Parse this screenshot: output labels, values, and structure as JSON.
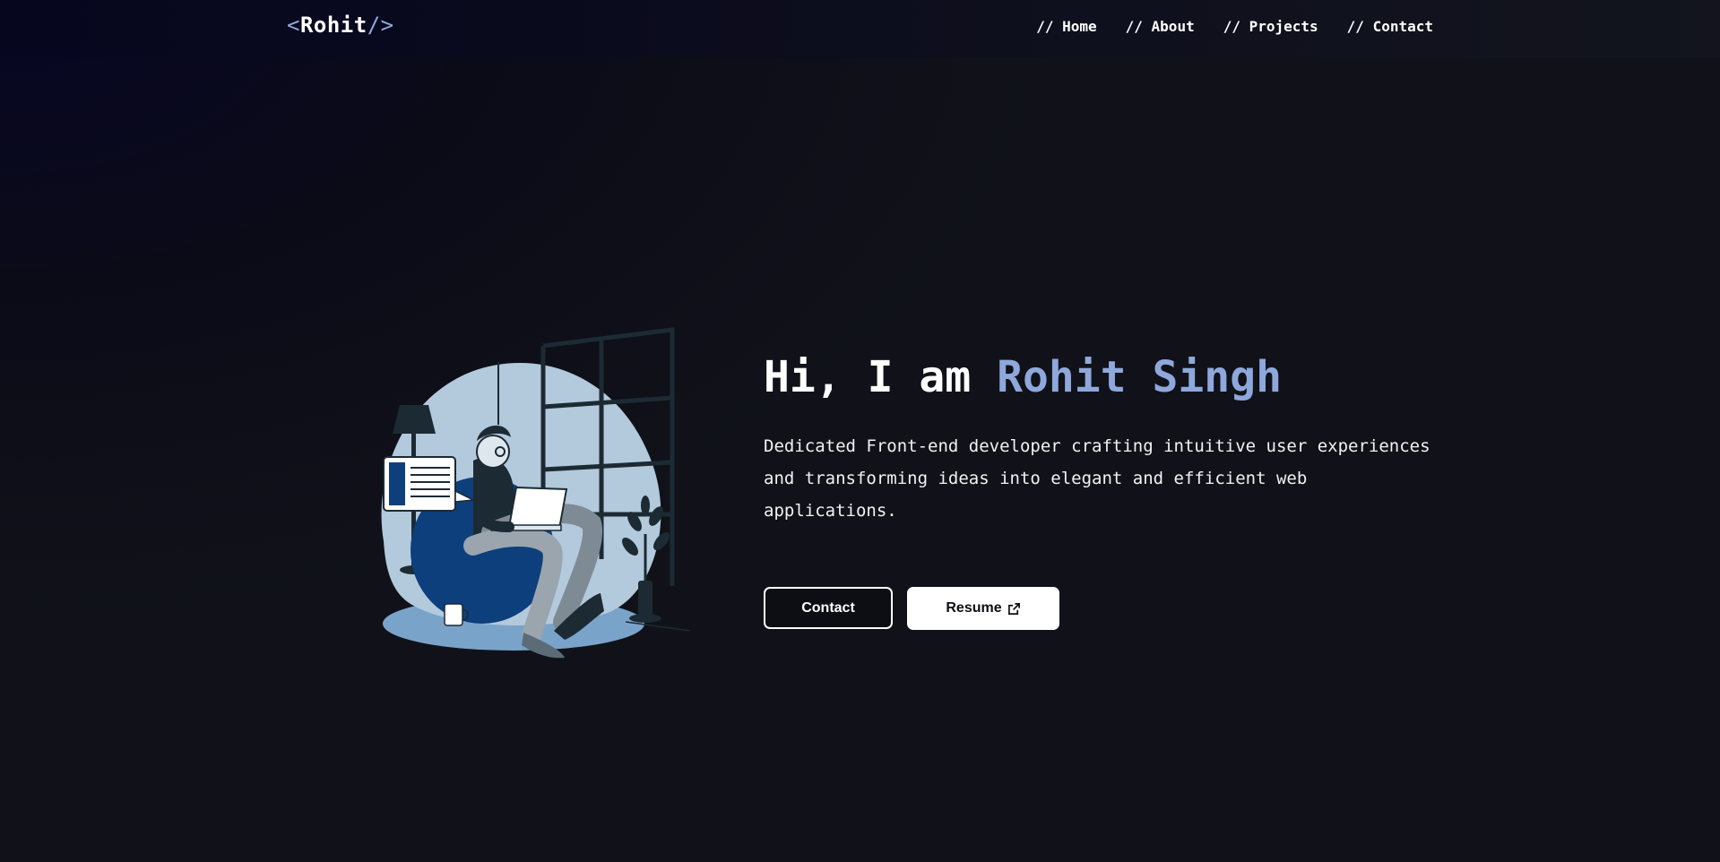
{
  "nav": {
    "logo_open": "<",
    "logo_name": "Rohit",
    "logo_close": "/>",
    "links": [
      "// Home",
      "// About",
      "// Projects",
      "// Contact"
    ]
  },
  "hero": {
    "greeting": "Hi, I am",
    "name": "Rohit Singh",
    "description": "Dedicated Front-end developer crafting intuitive user experiences and transforming ideas into elegant and efficient web applications.",
    "contact_label": "Contact",
    "resume_label": "Resume",
    "resume_icon": "external-link-icon",
    "illustration": "developer-on-beanbag-with-laptop"
  },
  "colors": {
    "accent": "#8ea8dc",
    "text": "#ffffff",
    "background": "#0b0b18"
  }
}
